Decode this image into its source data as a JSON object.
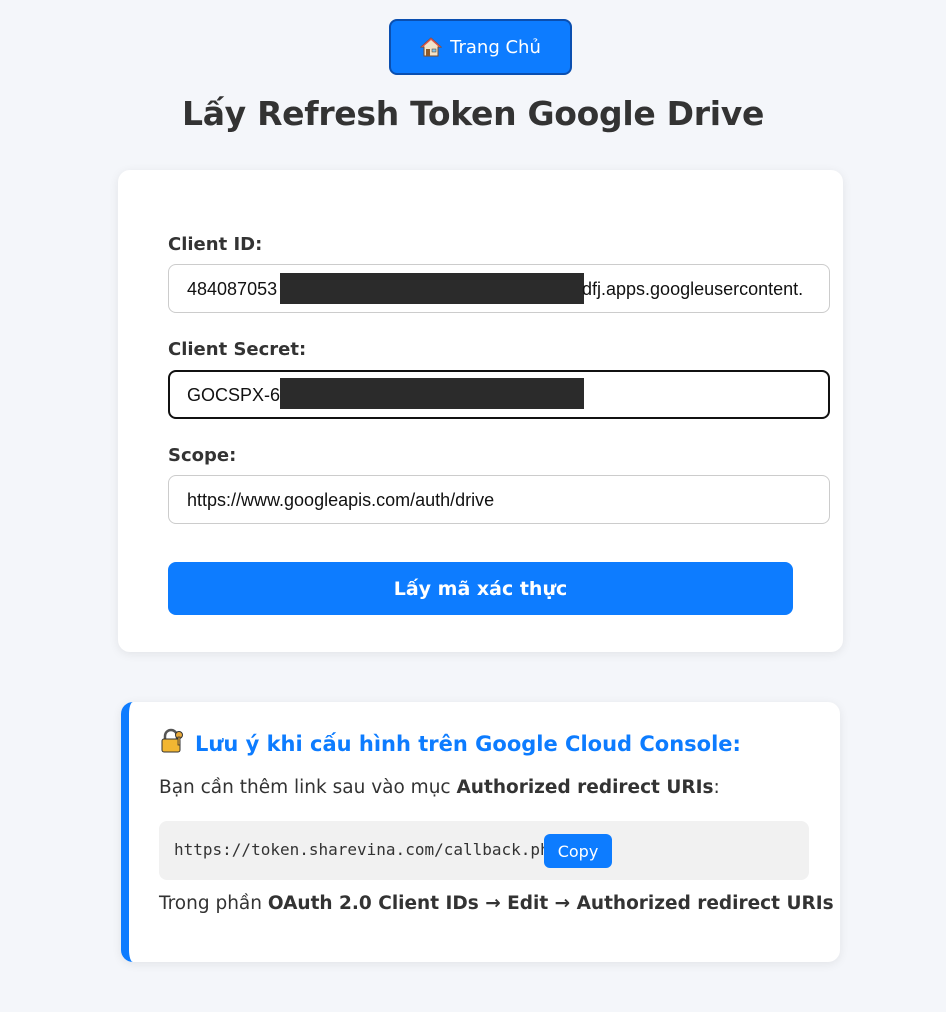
{
  "header": {
    "home_icon": "house-icon",
    "home_label": "Trang Chủ",
    "title": "Lấy Refresh Token Google Drive"
  },
  "form": {
    "client_id": {
      "label": "Client ID:",
      "value_start": "484087053",
      "value_end": "dfj.apps.googleusercontent."
    },
    "client_secret": {
      "label": "Client Secret:",
      "value_start": "GOCSPX-6"
    },
    "scope": {
      "label": "Scope:",
      "value": "https://www.googleapis.com/auth/drive"
    },
    "submit_label": "Lấy mã xác thực"
  },
  "note": {
    "icon": "lock-with-key-icon",
    "title": "Lưu ý khi cấu hình trên Google Cloud Console:",
    "line1_prefix": "Bạn cần thêm link sau vào mục ",
    "line1_bold": "Authorized redirect URIs",
    "line1_suffix": ":",
    "redirect_url": "https://token.sharevina.com/callback.php",
    "copy_label": "Copy",
    "line2_prefix": "Trong phần ",
    "line2_bold": "OAuth 2.0 Client IDs → Edit → Authorized redirect URIs"
  },
  "colors": {
    "accent": "#0d7cff",
    "background": "#f4f6fa",
    "redaction": "#2b2b2b"
  }
}
